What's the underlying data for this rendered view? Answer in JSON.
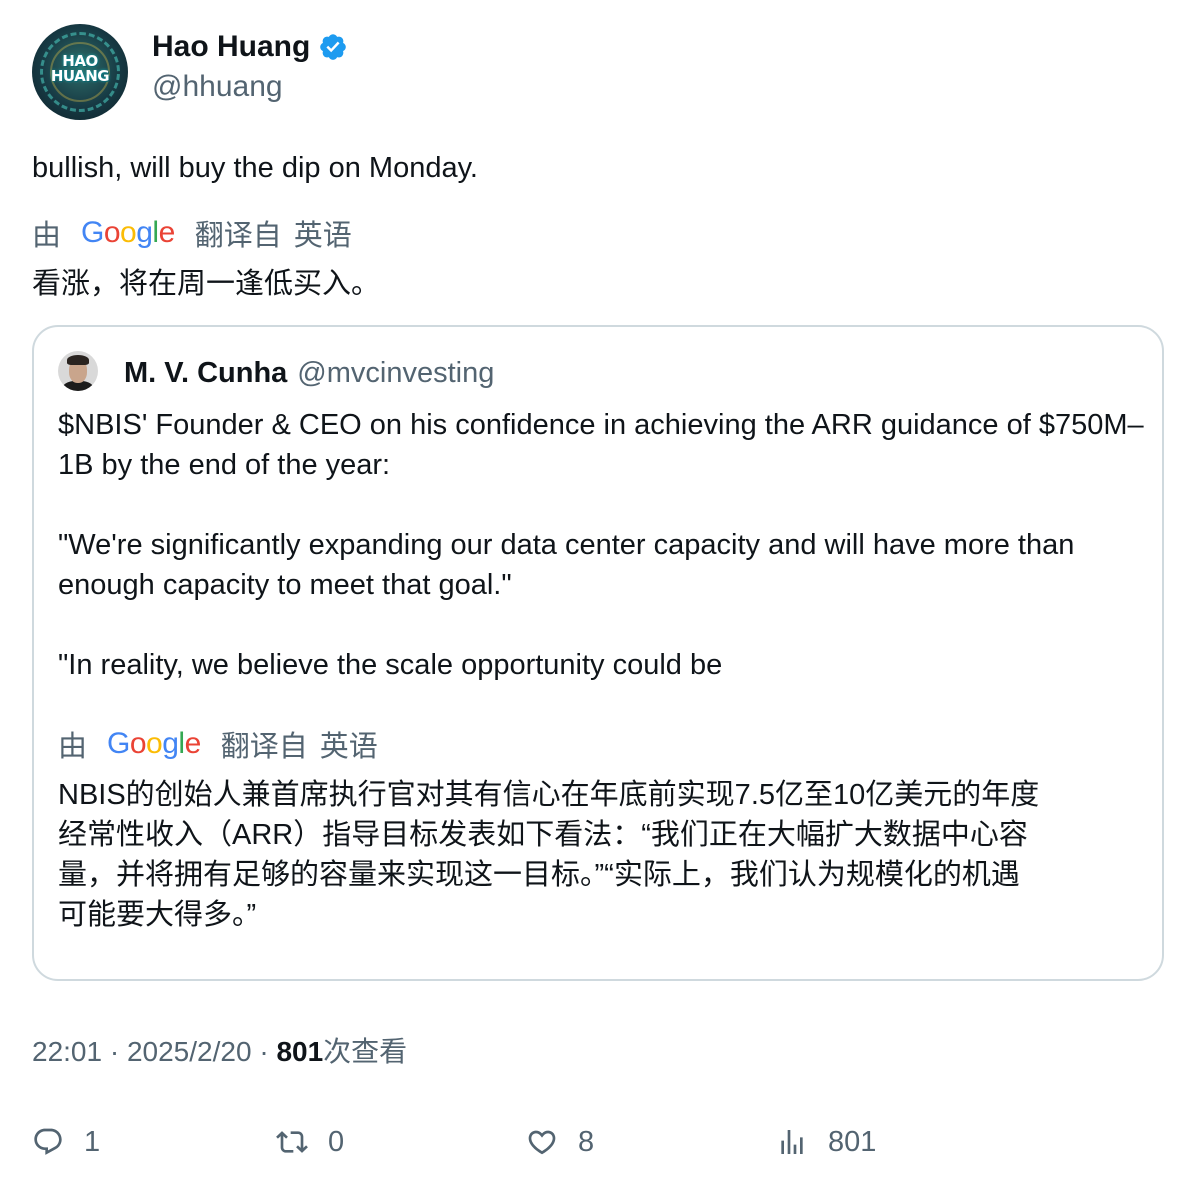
{
  "author": {
    "name": "Hao Huang",
    "handle": "@hhuang",
    "avatar_text_line1": "HAO",
    "avatar_text_line2": "HUANG",
    "verified": true,
    "verified_color": "#1d9bf0"
  },
  "tweet": {
    "text": "bullish, will buy the dip on Monday.",
    "translation": {
      "by": "由",
      "provider": "Google",
      "translated_from": "翻译自",
      "language": "英语",
      "text": "看涨，将在周一逢低买入。"
    }
  },
  "quoted_tweet": {
    "author_name": "M. V. Cunha",
    "author_handle": "@mvcinvesting",
    "paragraphs": [
      "$NBIS' Founder & CEO on his confidence in achieving the ARR guidance of $750M–1B by the end of the year:",
      "\"We're significantly expanding our data center capacity and will have more than enough capacity to meet that goal.\"",
      "\"In reality, we believe the scale opportunity could be"
    ],
    "translation": {
      "by": "由",
      "provider": "Google",
      "translated_from": "翻译自",
      "language": "英语",
      "lines": [
        "NBIS的创始人兼首席执行官对其有信心在年底前实现7.5亿至10亿美元的年度",
        "经常性收入（ARR）指导目标发表如下看法：“我们正在大幅扩大数据中心容",
        "量，并将拥有足够的容量来实现这一目标。”“实际上，我们认为规模化的机遇",
        "可能要大得多。”"
      ]
    }
  },
  "meta": {
    "time": "22:01",
    "separator": " · ",
    "date": "2025/2/20",
    "views_count": "801",
    "views_label": "次查看"
  },
  "actions": {
    "replies": "1",
    "retweets": "0",
    "likes": "8",
    "views": "801"
  },
  "colors": {
    "text_primary": "#0f1419",
    "text_secondary": "#536471",
    "border": "#cfd9de",
    "google_blue": "#4285F4",
    "google_red": "#EA4335",
    "google_yellow": "#FBBC05",
    "google_green": "#34A853"
  }
}
